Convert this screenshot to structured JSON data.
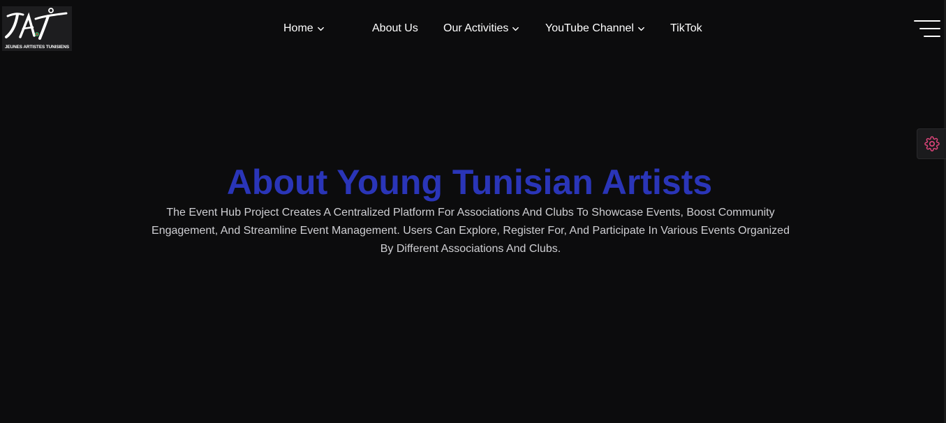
{
  "logo": {
    "caption": "JEUNES ARTISTES TUNISIENS"
  },
  "nav": {
    "items": [
      {
        "label": "Home",
        "has_dropdown": true
      },
      {
        "label": "About Us",
        "has_dropdown": false
      },
      {
        "label": "Our Activities",
        "has_dropdown": true
      },
      {
        "label": "YouTube Channel",
        "has_dropdown": true
      },
      {
        "label": "TikTok",
        "has_dropdown": false
      }
    ]
  },
  "icons": {
    "menu": "hamburger-menu-icon",
    "settings": "gear-icon",
    "dropdown": "chevron-down-icon"
  },
  "hero": {
    "title": "About Young Tunisian Artists",
    "description": "The Event Hub Project Creates A Centralized Platform For Associations And Clubs To Showcase Events, Boost Community Engagement, And Streamline Event Management. Users Can Explore, Register For, And Participate In Various Events Organized By Different Associations And Clubs."
  },
  "colors": {
    "background": "#0c0c0d",
    "title": "#2a35b8",
    "text": "#cfcfd3",
    "settings_accent": "#e0457b"
  }
}
